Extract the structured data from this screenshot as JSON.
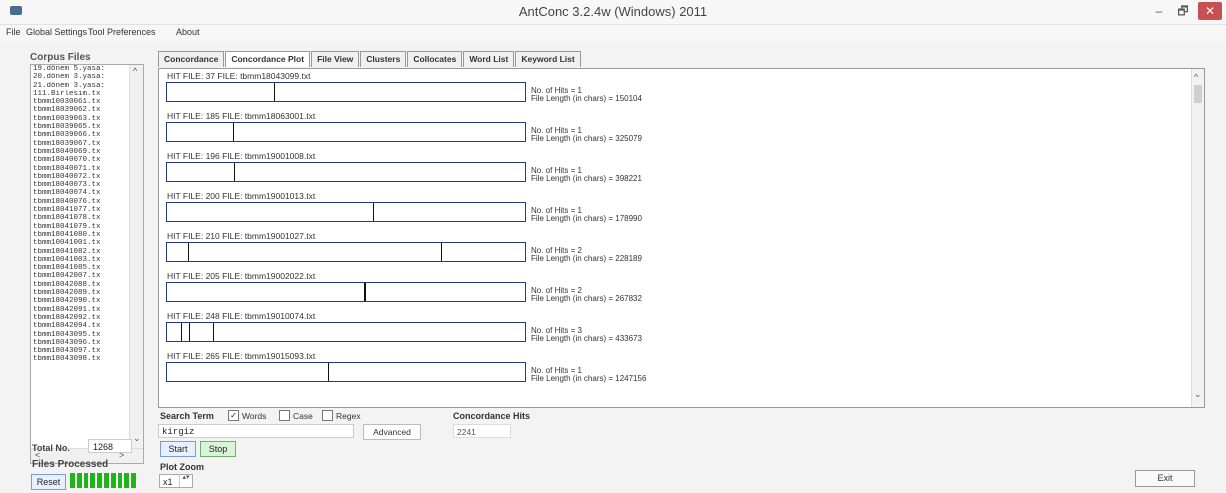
{
  "window": {
    "title": "AntConc 3.2.4w (Windows) 2011",
    "min": "–",
    "max": "🗗",
    "close": "✕"
  },
  "menu": [
    "File",
    "Global Settings",
    "Tool Preferences",
    "About"
  ],
  "left": {
    "corpus_label": "Corpus Files",
    "files": [
      "19.dönem 5.yasa:",
      "20.dönem 3.yasa:",
      "21.dönem 3.yasa:",
      "111.Birlesim.tx",
      "tbmm10030061.tx",
      "tbmm18039062.tx",
      "tbmm10039063.tx",
      "tbmm18039065.tx",
      "tbmm18039066.tx",
      "tbmm18039067.tx",
      "tbmm18040069.tx",
      "tbmm18040070.tx",
      "tbmm18040071.tx",
      "tbmm18040072.tx",
      "tbmm18040073.tx",
      "tbmm18040074.tx",
      "tbmm18040076.tx",
      "tbmm18041077.tx",
      "tbmm18041078.tx",
      "tbmm18041079.tx",
      "tbmm18041080.tx",
      "tbmm10041001.tx",
      "tbmm18041082.tx",
      "tbmm10041003.tx",
      "tbmm18041085.tx",
      "tbmm18042007.tx",
      "tbmm18042088.tx",
      "tbmm18042089.tx",
      "tbmm18042090.tx",
      "tbmm18042091.tx",
      "tbmm18042092.tx",
      "tbmm18042094.tx",
      "tbmm18043095.tx",
      "tbmm18043096.tx",
      "tbmm18043097.tx",
      "tbmm18043098.tx"
    ],
    "scroll_up": "^",
    "scroll_down": "⌄",
    "scroll_left": "<",
    "scroll_right": ">",
    "total_label": "Total No.",
    "total_value": "1268",
    "files_processed": "Files Processed",
    "reset": "Reset",
    "progress_blocks": 10
  },
  "tabs": [
    "Concordance",
    "Concordance Plot",
    "File View",
    "Clusters",
    "Collocates",
    "Word List",
    "Keyword List"
  ],
  "active_tab": 1,
  "plot": {
    "scroll_up": "^",
    "scroll_down": "⌄",
    "hits": [
      {
        "header": "HIT FILE: 37   FILE: tbmm18043099.txt",
        "nohits": "No. of Hits = 1",
        "length": "File Length (in chars) = 150104",
        "marks": [
          0.3
        ]
      },
      {
        "header": "HIT FILE: 185   FILE: tbmm18063001.txt",
        "nohits": "No. of Hits = 1",
        "length": "File Length (in chars) = 325079",
        "marks": [
          0.185
        ]
      },
      {
        "header": "HIT FILE: 196   FILE: tbmm19001008.txt",
        "nohits": "No. of Hits = 1",
        "length": "File Length (in chars) = 398221",
        "marks": [
          0.188
        ]
      },
      {
        "header": "HIT FILE: 200   FILE: tbmm19001013.txt",
        "nohits": "No. of Hits = 1",
        "length": "File Length (in chars) = 178990",
        "marks": [
          0.575
        ]
      },
      {
        "header": "HIT FILE: 210   FILE: tbmm19001027.txt",
        "nohits": "No. of Hits = 2",
        "length": "File Length (in chars) = 228189",
        "marks": [
          0.06,
          0.765
        ]
      },
      {
        "header": "HIT FILE: 205   FILE: tbmm19002022.txt",
        "nohits": "No. of Hits = 2",
        "length": "File Length (in chars) = 267832",
        "marks": [
          0.55,
          0.553
        ]
      },
      {
        "header": "HIT FILE: 248   FILE: tbmm19010074.txt",
        "nohits": "No. of Hits = 3",
        "length": "File Length (in chars) = 433673",
        "marks": [
          0.038,
          0.062,
          0.128
        ]
      },
      {
        "header": "HIT FILE: 265   FILE: tbmm19015093.txt",
        "nohits": "No. of Hits = 1",
        "length": "File Length (in chars) = 1247156",
        "marks": [
          0.45
        ]
      }
    ]
  },
  "search": {
    "term_label": "Search Term",
    "words_label": "Words",
    "words_checked": true,
    "case_label": "Case",
    "case_checked": false,
    "regex_label": "Regex",
    "regex_checked": false,
    "value": "kirgiz",
    "advanced": "Advanced",
    "hits_label": "Concordance Hits",
    "hits_count": "2241",
    "start": "Start",
    "stop": "Stop",
    "zoom_label": "Plot Zoom",
    "zoom_value": "x1",
    "zoom_spin": "▴▾"
  },
  "exit": "Exit"
}
